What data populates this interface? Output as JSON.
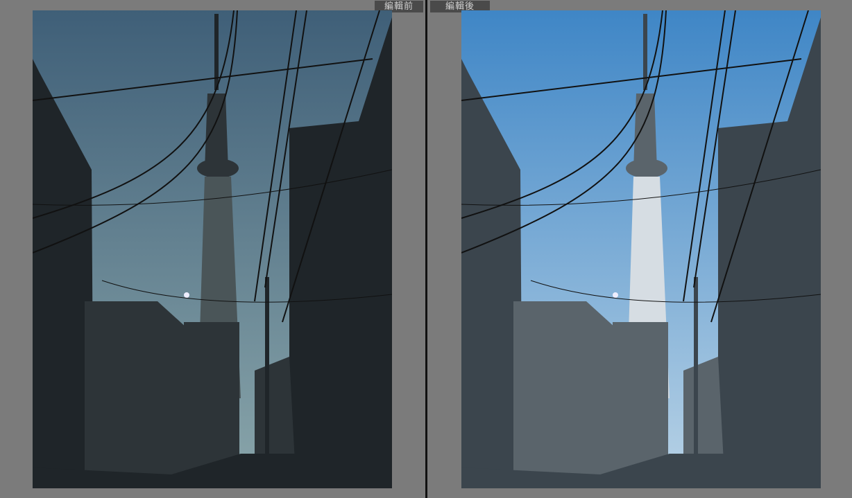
{
  "labels": {
    "before": "編輯前",
    "after": "編輯後"
  },
  "colors": {
    "before_sky_top": "#3f5f78",
    "before_sky_bottom": "#8aa6ab",
    "after_sky_top": "#3f86c6",
    "after_sky_bottom": "#b9d3e6"
  }
}
